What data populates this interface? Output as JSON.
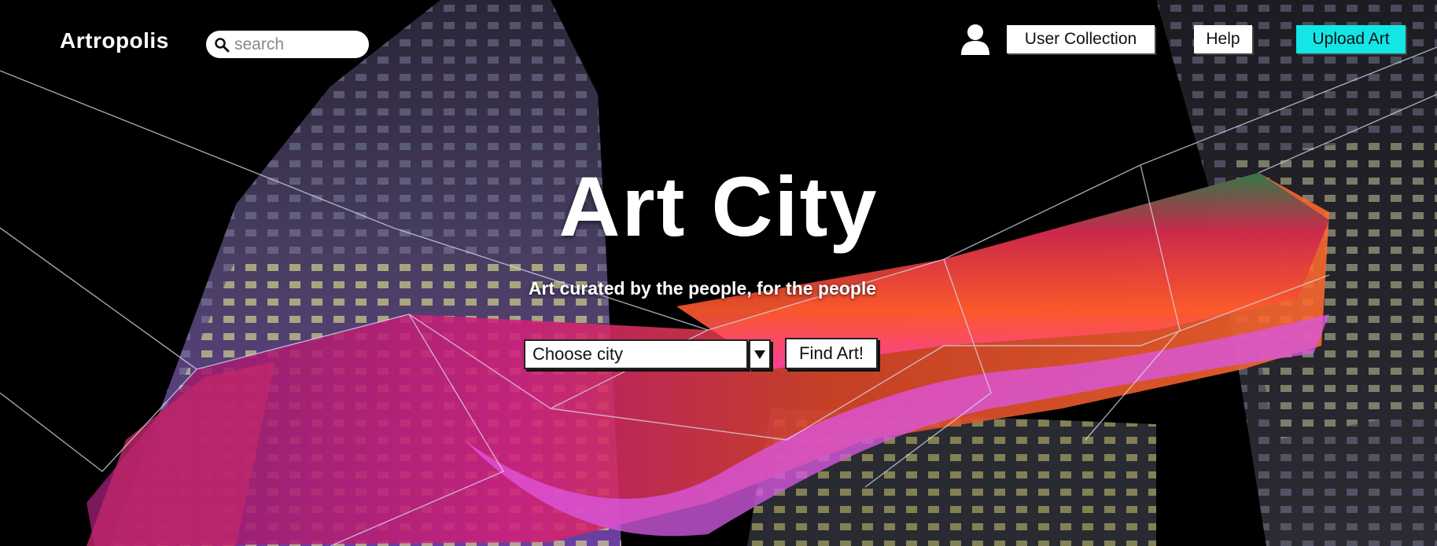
{
  "header": {
    "brand": "Artropolis",
    "search_placeholder": "search",
    "nav": {
      "user_collection": "User Collection",
      "help": "Help",
      "upload_art": "Upload Art"
    }
  },
  "hero": {
    "title": "Art City",
    "subtitle": "Art curated by the people, for the people",
    "city_select_value": "Choose city",
    "find_button": "Find Art!"
  },
  "colors": {
    "accent": "#12e6e6",
    "background": "#000000"
  },
  "icons": [
    "search-icon",
    "user-icon",
    "caret-down-icon"
  ]
}
